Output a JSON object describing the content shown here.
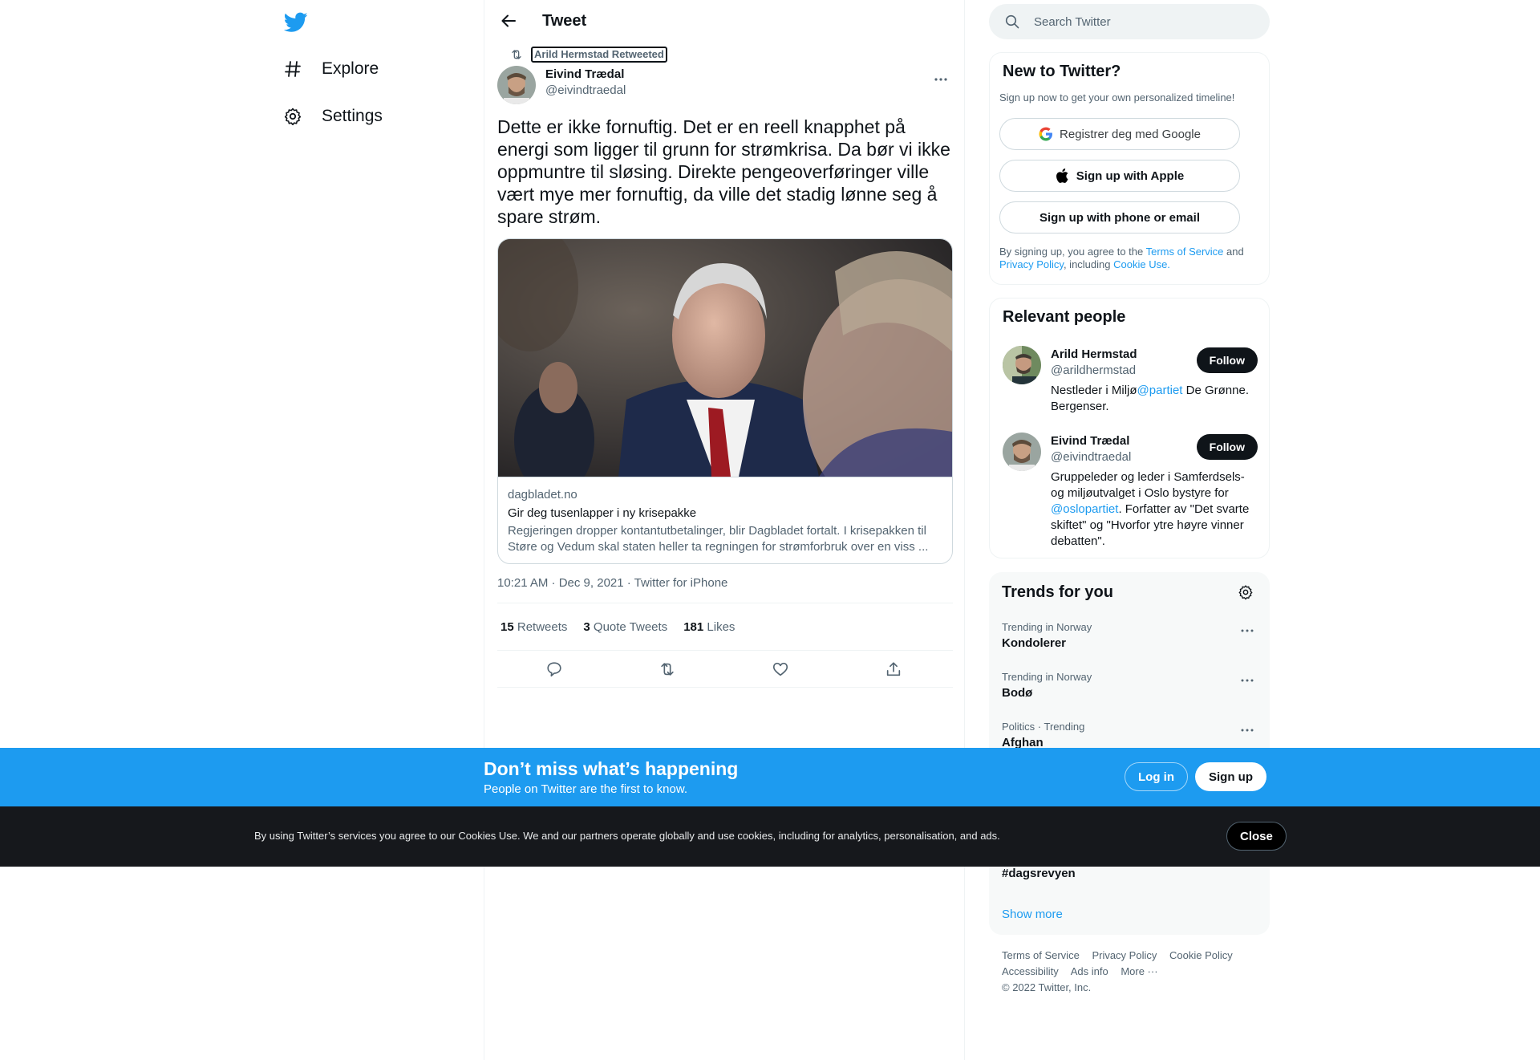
{
  "nav": {
    "logo": "twitter-bird-icon",
    "items": [
      {
        "label": "Explore",
        "icon": "hashtag-icon"
      },
      {
        "label": "Settings",
        "icon": "gear-icon"
      }
    ]
  },
  "header": {
    "title": "Tweet"
  },
  "tweet": {
    "retweeted_by": "Arild Hermstad Retweeted",
    "author_name": "Eivind Trædal",
    "author_handle": "@eivindtraedal",
    "text": "Dette er ikke fornuftig. Det er en reell knapphet på energi som ligger til grunn for strømkrisa. Da bør vi ikke oppmuntre til sløsing. Direkte pengeoverføringer ville vært mye mer fornuftig, da ville det stadig lønne seg å spare strøm.",
    "card": {
      "domain": "dagbladet.no",
      "title": "Gir deg tusenlapper i ny krisepakke",
      "description": "Regjeringen dropper kontantutbetalinger, blir Dagbladet fortalt. I krisepakken til Støre og Vedum skal staten heller ta regningen for strømforbruk over en viss ..."
    },
    "timestamp": "10:21 AM · Dec 9, 2021 · Twitter for iPhone",
    "stats": {
      "retweets_count": "15",
      "retweets_label": "Retweets",
      "quotes_count": "3",
      "quotes_label": "Quote Tweets",
      "likes_count": "181",
      "likes_label": "Likes"
    }
  },
  "search": {
    "placeholder": "Search Twitter"
  },
  "new_to_twitter": {
    "title": "New to Twitter?",
    "subtitle": "Sign up now to get your own personalized timeline!",
    "google_label": "Registrer deg med Google",
    "apple_label": "Sign up with Apple",
    "phone_label": "Sign up with phone or email",
    "legal_prefix": "By signing up, you agree to the ",
    "terms_link": "Terms of Service",
    "legal_and": " and ",
    "privacy_link": "Privacy Policy",
    "legal_including": ", including ",
    "cookie_link": "Cookie Use."
  },
  "relevant_people": {
    "title": "Relevant people",
    "people": [
      {
        "name": "Arild Hermstad",
        "handle": "@arildhermstad",
        "follow_label": "Follow",
        "bio_pre": "Nestleder i Miljø",
        "bio_link": "@partiet",
        "bio_post": " De Grønne. Bergenser."
      },
      {
        "name": "Eivind Trædal",
        "handle": "@eivindtraedal",
        "follow_label": "Follow",
        "bio_pre": "Gruppeleder og leder i Samferdsels- og miljøutvalget i Oslo bystyre for ",
        "bio_link": "@oslopartiet",
        "bio_post": ". Forfatter av \"Det svarte skiftet\" og \"Hvorfor ytre høyre vinner debatten\"."
      }
    ]
  },
  "trends": {
    "title": "Trends for you",
    "items": [
      {
        "meta": "Trending in Norway",
        "name": "Kondolerer"
      },
      {
        "meta": "Trending in Norway",
        "name": "Bodø"
      },
      {
        "meta": "Politics · Trending",
        "name": "Afghan"
      },
      {
        "meta": "",
        "name": "#dagsrevyen"
      }
    ],
    "show_more": "Show more"
  },
  "footer": {
    "links": [
      "Terms of Service",
      "Privacy Policy",
      "Cookie Policy",
      "Accessibility",
      "Ads info",
      "More ···"
    ],
    "copyright": "© 2022 Twitter, Inc."
  },
  "signup_bar": {
    "title": "Don’t miss what’s happening",
    "subtitle": "People on Twitter are the first to know.",
    "login_label": "Log in",
    "signup_label": "Sign up"
  },
  "cookie_bar": {
    "text": "By using Twitter’s services you agree to our Cookies Use. We and our partners operate globally and use cookies, including for analytics, personalisation, and ads.",
    "close_label": "Close"
  },
  "colors": {
    "accent": "#1d9bf0",
    "text": "#0f1419",
    "muted": "#536471",
    "cookie_bg": "#16181c"
  }
}
